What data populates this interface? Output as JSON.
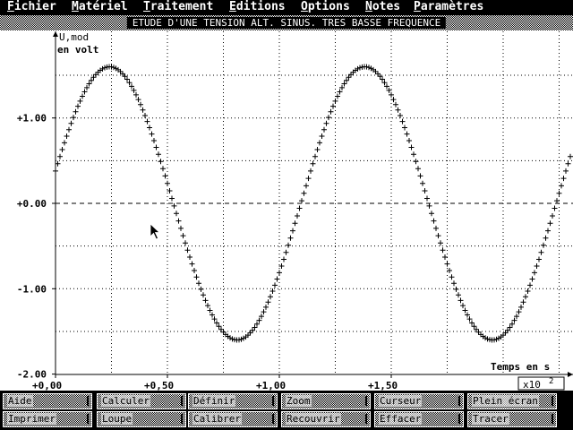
{
  "menu": [
    {
      "underline": "F",
      "rest": "ichier"
    },
    {
      "underline": "M",
      "rest": "atériel"
    },
    {
      "underline": "T",
      "rest": "raitement"
    },
    {
      "underline": "E",
      "rest": "ditions"
    },
    {
      "underline": "O",
      "rest": "ptions"
    },
    {
      "underline": "N",
      "rest": "otes"
    },
    {
      "underline": "P",
      "rest": "aramètres"
    }
  ],
  "window_title": "ETUDE D'UNE TENSION ALT. SINUS. TRES BASSE FREQUENCE",
  "plot": {
    "ylabel_series": "U,mod",
    "ylabel_unit": "en volt",
    "xlabel": "Temps en s",
    "x_multiplier_base": "x10",
    "x_multiplier_exp": "2"
  },
  "chart_data": {
    "type": "scatter",
    "title": "ETUDE D'UNE TENSION ALT. SINUS. TRES BASSE FREQUENCE",
    "xlabel": "Temps en s",
    "ylabel": "U,mod en volt",
    "x_tick_labels": [
      "+0,00",
      "+0,50",
      "+1,00",
      "+1,50"
    ],
    "y_tick_labels": [
      "+1.00",
      "+0.00",
      "-1.00",
      "-2.00"
    ],
    "x_ticks": [
      0,
      0.5,
      1.0,
      1.5
    ],
    "y_ticks": [
      1,
      0,
      -1,
      -2
    ],
    "xlim": [
      0,
      2.3
    ],
    "ylim": [
      -2,
      2
    ],
    "grid": true,
    "zero_line": "dashed",
    "marker": "+",
    "series": [
      {
        "amplitude": 1.6,
        "period": 1.14,
        "phase_deg": 13.7,
        "x_start": 0,
        "x_end": 2.3,
        "sample_step": 0.01
      }
    ]
  },
  "toolbar": [
    [
      "Aide",
      "Calculer",
      "Définir",
      "Zoom",
      "Curseur",
      "Plein écran"
    ],
    [
      "Imprimer",
      "Loupe",
      "Calibrer",
      "Recouvrir",
      "Effacer",
      "Tracer"
    ]
  ]
}
